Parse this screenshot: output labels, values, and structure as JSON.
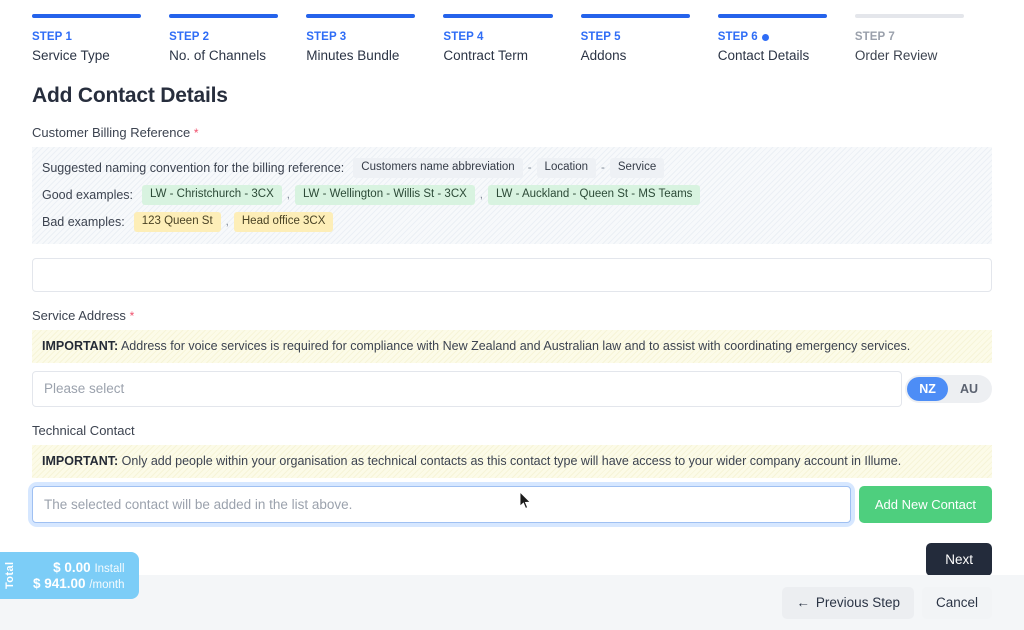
{
  "stepper": {
    "steps": [
      {
        "num": "STEP 1",
        "label": "Service Type",
        "state": "done"
      },
      {
        "num": "STEP 2",
        "label": "No. of Channels",
        "state": "done"
      },
      {
        "num": "STEP 3",
        "label": "Minutes Bundle",
        "state": "done"
      },
      {
        "num": "STEP 4",
        "label": "Contract Term",
        "state": "done"
      },
      {
        "num": "STEP 5",
        "label": "Addons",
        "state": "done"
      },
      {
        "num": "STEP 6",
        "label": "Contact Details",
        "state": "current"
      },
      {
        "num": "STEP 7",
        "label": "Order Review",
        "state": "inactive"
      }
    ]
  },
  "page": {
    "title": "Add Contact Details"
  },
  "billing": {
    "label": "Customer Billing Reference",
    "required_mark": "*",
    "convention_lead": "Suggested naming convention for the billing reference:",
    "convention_chips": [
      "Customers name abbreviation",
      "Location",
      "Service"
    ],
    "convention_sep": "-",
    "good_lead": "Good examples:",
    "good_examples": [
      "LW - Christchurch - 3CX",
      "LW - Wellington - Willis St - 3CX",
      "LW - Auckland - Queen St - MS Teams"
    ],
    "bad_lead": "Bad examples:",
    "bad_examples": [
      "123 Queen St",
      "Head office 3CX"
    ],
    "comma": ",",
    "input_value": "",
    "input_placeholder": ""
  },
  "service_address": {
    "label": "Service Address",
    "required_mark": "*",
    "note_strong": "IMPORTANT:",
    "note_text": "Address for voice services is required for compliance with New Zealand and Australian law and to assist with coordinating emergency services.",
    "select_placeholder": "Please select",
    "select_value": "",
    "country_options": [
      "NZ",
      "AU"
    ],
    "country_selected": "NZ"
  },
  "technical_contact": {
    "label": "Technical Contact",
    "note_strong": "IMPORTANT:",
    "note_text": "Only add people within your organisation as technical contacts as this contact type will have access to your wider company account in Illume.",
    "input_placeholder": "The selected contact will be added in the list above.",
    "input_value": "",
    "add_button": "Add New Contact"
  },
  "actions": {
    "next": "Next",
    "previous": "Previous Step",
    "previous_arrow": "←",
    "cancel": "Cancel"
  },
  "footer": {
    "total_word": "Total",
    "install_amount": "$ 0.00",
    "install_unit": "Install",
    "monthly_amount": "$ 941.00",
    "monthly_unit": "/month"
  },
  "colors": {
    "accent_blue": "#2f6df6",
    "toggle_blue": "#4d8df6",
    "green_button": "#4ecf7e",
    "next_dark": "#232b3b",
    "total_badge": "#7ccdf7",
    "required_red": "#f0516d"
  }
}
